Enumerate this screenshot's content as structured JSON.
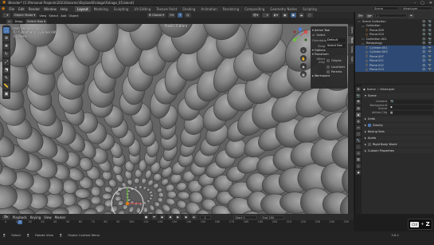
{
  "window": {
    "title": "Blender* [C:\\Personal Projects\\2023\\Seismic\\Stylized\\Foliage\\Foliage_05.blend]",
    "controls": [
      "–",
      "▢",
      "✕"
    ]
  },
  "menubar": {
    "items": [
      "File",
      "Edit",
      "Render",
      "Window",
      "Help"
    ],
    "workspaces": [
      {
        "label": "Layout",
        "active": true
      },
      {
        "label": "Modeling",
        "active": false
      },
      {
        "label": "Sculpting",
        "active": false
      },
      {
        "label": "UV Editing",
        "active": false
      },
      {
        "label": "Texture Paint",
        "active": false
      },
      {
        "label": "Shading",
        "active": false
      },
      {
        "label": "Animation",
        "active": false
      },
      {
        "label": "Rendering",
        "active": false
      },
      {
        "label": "Compositing",
        "active": false
      },
      {
        "label": "Geometry Nodes",
        "active": false
      },
      {
        "label": "Scripting",
        "active": false
      }
    ],
    "scene_label": "Scene",
    "viewlayer_label": "ViewLayer"
  },
  "header3d": {
    "mode": "Object Mode",
    "view": "View",
    "select": "Select",
    "add": "Add",
    "object": "Object",
    "orientation": "Global",
    "snap_label": "⌖"
  },
  "toolheader": {
    "drag": "Drag:",
    "drag_value": "Select Box"
  },
  "viewport": {
    "info_lines": [
      "User Perspective",
      "(1) Collection | Cylinder.009",
      "10 Pixels"
    ],
    "mode_label": "Pixels: 5.8mm"
  },
  "npanel": {
    "active_tool_label": "Active Tool",
    "select_label": "Select",
    "orientation_label": "Orientation",
    "orientation_value": "Default",
    "drag_label": "Drag",
    "drag_value": "Select Box",
    "options_label": "Options",
    "transform_label": "Transform",
    "affect_only_label": "Affect Only",
    "origins_label": "Origins",
    "locations_label": "Locations",
    "parents_label": "Parents",
    "workspace_label": "Workspace"
  },
  "side_tabs": [
    "Item",
    "Tool",
    "View",
    "Edit"
  ],
  "outliner": {
    "items": [
      {
        "label": "Scene Collection",
        "icon": "collection-icon",
        "selected": false,
        "indent": 0
      },
      {
        "label": "Collection",
        "icon": "collection-icon",
        "selected": false,
        "indent": 1
      },
      {
        "label": "Plane.009",
        "icon": "mesh-icon",
        "selected": false,
        "indent": 2
      },
      {
        "label": "Plane.010",
        "icon": "mesh-icon",
        "selected": false,
        "indent": 2
      },
      {
        "label": "Collection.001",
        "icon": "collection-icon",
        "selected": false,
        "indent": 1
      },
      {
        "label": "Retopology",
        "icon": "collection-icon",
        "selected": false,
        "indent": 1
      },
      {
        "label": "Cylinder.001",
        "icon": "mesh-icon",
        "selected": true,
        "indent": 2
      },
      {
        "label": "Cylinder.003",
        "icon": "mesh-icon",
        "selected": true,
        "indent": 2
      },
      {
        "label": "Plane.007",
        "icon": "mesh-icon",
        "selected": true,
        "indent": 2
      },
      {
        "label": "Plane.011",
        "icon": "mesh-icon",
        "selected": true,
        "indent": 2
      },
      {
        "label": "Plane.012",
        "icon": "mesh-icon",
        "selected": true,
        "indent": 2
      },
      {
        "label": "Plane.013",
        "icon": "mesh-icon",
        "selected": true,
        "indent": 2
      }
    ]
  },
  "properties": {
    "breadcrumb": "Scene",
    "viewlayer": "ViewLayer",
    "section_scene": "Scene",
    "camera_label": "Camera",
    "background_scene_label": "Background Scene",
    "active_clip_label": "Active Clip",
    "sections": [
      "Units",
      "Gravity",
      "Keying Sets",
      "Audio",
      "Rigid Body World",
      "Custom Properties"
    ]
  },
  "timeline": {
    "playback": "Playback",
    "keying": "Keying",
    "view": "View",
    "marker": "Marker",
    "current_frame": "1",
    "start_label": "Start",
    "start_value": "1",
    "end_label": "End",
    "end_value": "250",
    "ticks": [
      "0",
      "10",
      "20",
      "30",
      "40",
      "50",
      "60",
      "70",
      "80",
      "90",
      "100",
      "110",
      "120",
      "130",
      "140",
      "150",
      "160",
      "170",
      "180",
      "190",
      "200",
      "210",
      "220",
      "230",
      "240",
      "250"
    ]
  },
  "statusbar": {
    "select": "Select",
    "rotate_view": "Rotate View",
    "context_menu": "Object Context Menu",
    "version": "3.6.1"
  },
  "shortcut": {
    "mod": "Ctrl",
    "plus": "+",
    "key": "Z"
  }
}
